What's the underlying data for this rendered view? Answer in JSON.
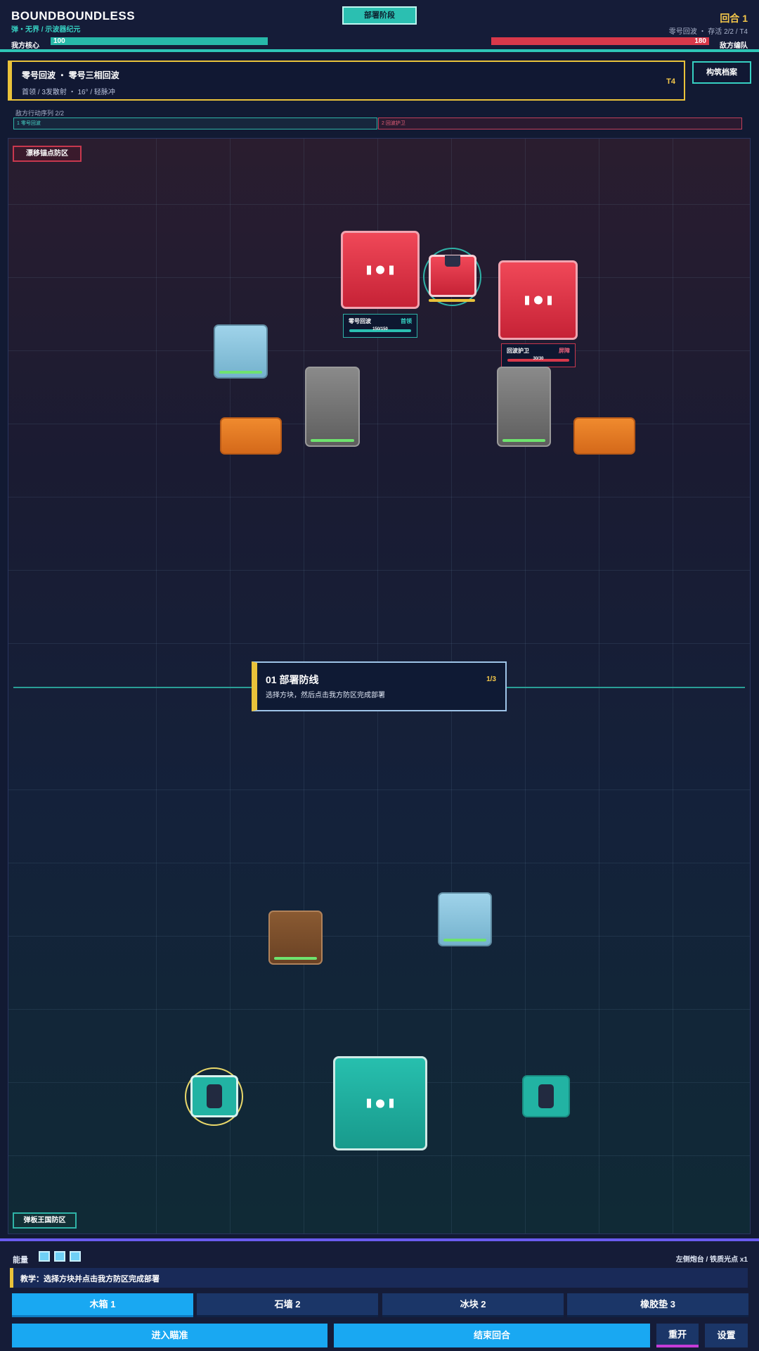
{
  "header": {
    "title": "BOUNDBOUNDLESS",
    "subtitle": "弹・无界 / 示波器纪元",
    "phase": "部署阶段",
    "round": "回合 1",
    "round_info": "零号回波 ・ 存活 2/2 / T4",
    "core_label": "我方核心",
    "core_value": "100",
    "core_fill": 1.0,
    "enemy_label": "敌方编队",
    "enemy_value": "180",
    "enemy_fill": 1.0
  },
  "boss": {
    "name": "零号回波 ・ 零号三相回波",
    "desc": "首领 / 3发散射 ・ 16° / 轻脉冲",
    "tier": "T4"
  },
  "archive_button": "构筑档案",
  "queue": {
    "title": "敌方行动序列 2/2",
    "items": [
      "1 零号回波",
      "2 回波护卫"
    ]
  },
  "zones": {
    "enemy": "漂移锚点防区",
    "player": "弹板王国防区"
  },
  "units": {
    "boss": {
      "name": "零号回波",
      "tag": "首领",
      "hp": "150/150"
    },
    "guard": {
      "name": "回波护卫",
      "tag": "屏障",
      "hp": "30/30"
    }
  },
  "tutorial": {
    "title": "01 部署防线",
    "desc": "选择方块，然后点击我方防区完成部署",
    "step": "1/3"
  },
  "bottom": {
    "energy_label": "能量",
    "energy_count": 3,
    "turret_info": "左侧炮台 / 铁质光点 x1",
    "hint": "教学：选择方块并点击我方防区完成部署",
    "blocks": [
      {
        "label": "木箱 1",
        "selected": true
      },
      {
        "label": "石墙 2",
        "selected": false
      },
      {
        "label": "冰块 2",
        "selected": false
      },
      {
        "label": "橡胶垫 3",
        "selected": false
      }
    ],
    "aim_button": "进入瞄准",
    "end_turn_button": "结束回合",
    "restart_button": "重开",
    "settings_button": "设置"
  },
  "colors": {
    "accent_teal": "#2ec6b6",
    "accent_gold": "#e9c23a",
    "enemy_red": "#d8384a",
    "button_blue": "#19a8f2"
  }
}
